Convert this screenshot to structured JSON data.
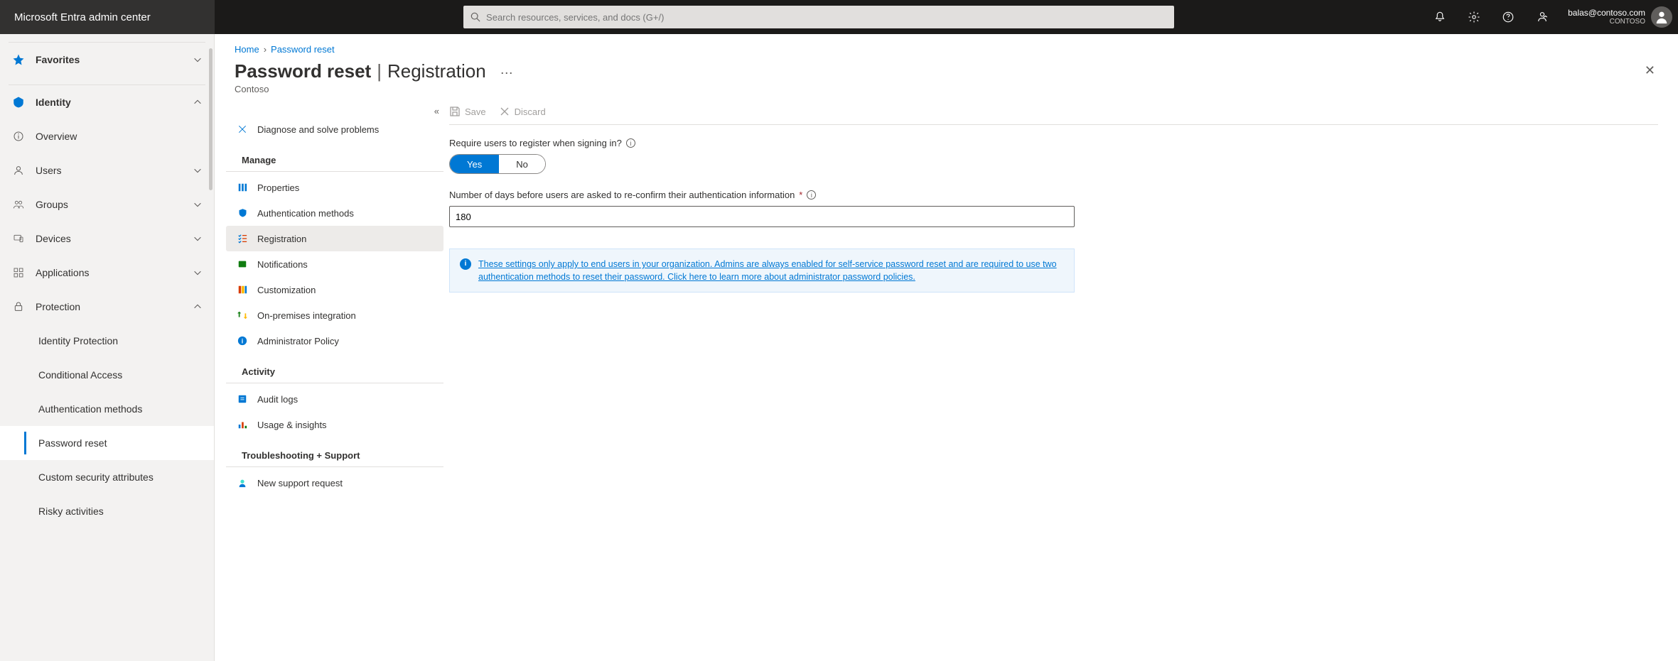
{
  "header": {
    "brand": "Microsoft Entra admin center",
    "search_placeholder": "Search resources, services, and docs (G+/)",
    "account_email": "balas@contoso.com",
    "account_org": "CONTOSO"
  },
  "sidebar": {
    "items": [
      {
        "label": "Favorites",
        "expandable": true
      },
      {
        "label": "Identity",
        "expandable": true,
        "expanded": true
      },
      {
        "label": "Overview"
      },
      {
        "label": "Users",
        "expandable": true
      },
      {
        "label": "Groups",
        "expandable": true
      },
      {
        "label": "Devices",
        "expandable": true
      },
      {
        "label": "Applications",
        "expandable": true
      },
      {
        "label": "Protection",
        "expandable": true,
        "expanded": true
      },
      {
        "label": "Identity Protection",
        "sub": true
      },
      {
        "label": "Conditional Access",
        "sub": true
      },
      {
        "label": "Authentication methods",
        "sub": true
      },
      {
        "label": "Password reset",
        "sub": true,
        "selected": true
      },
      {
        "label": "Custom security attributes",
        "sub": true
      },
      {
        "label": "Risky activities",
        "sub": true
      }
    ]
  },
  "breadcrumb": {
    "home": "Home",
    "section": "Password reset"
  },
  "page": {
    "title_main": "Password reset",
    "title_sub": "Registration",
    "subtitle": "Contoso"
  },
  "subnav": {
    "diagnose": "Diagnose and solve problems",
    "heading_manage": "Manage",
    "manage_items": [
      {
        "label": "Properties",
        "icon": "properties-icon"
      },
      {
        "label": "Authentication methods",
        "icon": "shield-icon"
      },
      {
        "label": "Registration",
        "icon": "checklist-icon",
        "active": true
      },
      {
        "label": "Notifications",
        "icon": "notification-icon"
      },
      {
        "label": "Customization",
        "icon": "palette-icon"
      },
      {
        "label": "On-premises integration",
        "icon": "sync-icon"
      },
      {
        "label": "Administrator Policy",
        "icon": "info-circle-icon"
      }
    ],
    "heading_activity": "Activity",
    "activity_items": [
      {
        "label": "Audit logs",
        "icon": "log-icon"
      },
      {
        "label": "Usage & insights",
        "icon": "chart-icon"
      }
    ],
    "heading_support": "Troubleshooting + Support",
    "support_items": [
      {
        "label": "New support request",
        "icon": "support-icon"
      }
    ]
  },
  "toolbar": {
    "save": "Save",
    "discard": "Discard"
  },
  "form": {
    "require_label": "Require users to register when signing in?",
    "yes": "Yes",
    "no": "No",
    "days_label": "Number of days before users are asked to re-confirm their authentication information",
    "days_value": "180",
    "info_text": "These settings only apply to end users in your organization. Admins are always enabled for self-service password reset and are required to use two authentication methods to reset their password. Click here to learn more about administrator password policies."
  }
}
